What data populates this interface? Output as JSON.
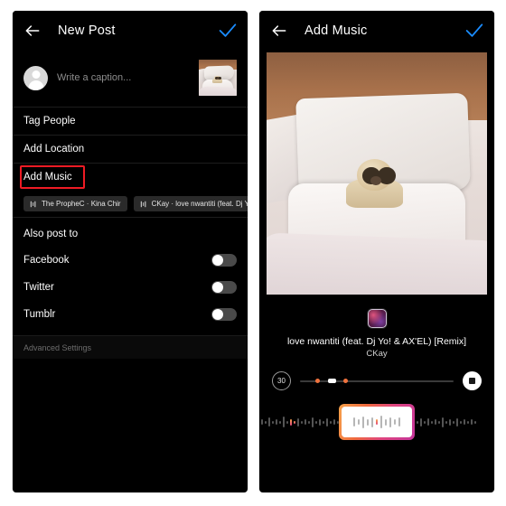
{
  "left_screen": {
    "header": {
      "title": "New Post",
      "back_icon": "arrow-left-icon",
      "confirm_icon": "check-icon",
      "confirm_color": "#1a8cff"
    },
    "caption": {
      "placeholder": "Write a caption...",
      "avatar_icon": "avatar-placeholder-icon",
      "thumbnail_alt": "dog-on-bed-thumbnail"
    },
    "options": [
      {
        "label": "Tag People",
        "highlighted": false
      },
      {
        "label": "Add Location",
        "highlighted": false
      },
      {
        "label": "Add Music",
        "highlighted": true
      }
    ],
    "highlight_color": "#ee1b24",
    "music_chips": [
      {
        "icon": "music-note-icon",
        "label": "The PropheC · Kina Chir"
      },
      {
        "icon": "music-note-icon",
        "label": "CKay · love nwantiti (feat. Dj Yo! & AX'EL"
      }
    ],
    "also_post_to": {
      "label": "Also post to",
      "items": [
        {
          "label": "Facebook",
          "enabled": false
        },
        {
          "label": "Twitter",
          "enabled": false
        },
        {
          "label": "Tumblr",
          "enabled": false
        }
      ]
    },
    "advanced_settings_label": "Advanced Settings"
  },
  "right_screen": {
    "header": {
      "title": "Add Music",
      "back_icon": "arrow-left-icon",
      "confirm_icon": "check-icon",
      "confirm_color": "#1a8cff"
    },
    "media_alt": "dog-on-bed-photo",
    "track": {
      "album_art_alt": "album-cover-art",
      "title": "love nwantiti (feat. Dj Yo! & AX'EL) [Remix]",
      "artist": "CKay"
    },
    "controls": {
      "duration_badge": "30",
      "stop_icon": "stop-icon",
      "scrubber_markers": 2
    },
    "waveform": {
      "selection_gradient_start": "#f7a34a",
      "selection_gradient_end": "#c4359b",
      "total_bars": 60,
      "selection_bars": 11
    }
  }
}
